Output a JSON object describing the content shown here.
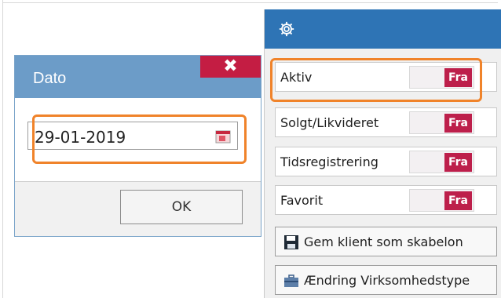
{
  "dialog": {
    "title": "Dato",
    "close_glyph": "✖",
    "date_value": "29-01-2019",
    "ok_label": "OK",
    "calendar_icon": "calendar-icon"
  },
  "panel": {
    "header_icon": "gear-icon",
    "rows": [
      {
        "label": "Aktiv",
        "toggle": "Fra"
      },
      {
        "label": "Solgt/Likvideret",
        "toggle": "Fra"
      },
      {
        "label": "Tidsregistrering",
        "toggle": "Fra"
      },
      {
        "label": "Favorit",
        "toggle": "Fra"
      }
    ],
    "buttons": [
      {
        "label": "Gem klient som skabelon",
        "icon": "save-icon"
      },
      {
        "label": "Ændring Virksomhedstype",
        "icon": "briefcase-icon"
      }
    ]
  },
  "colors": {
    "header_blue": "#2e74b5",
    "dialog_title_blue": "#6c9cc8",
    "toggle_red": "#bd1f4b",
    "highlight_orange": "#f0832a"
  }
}
